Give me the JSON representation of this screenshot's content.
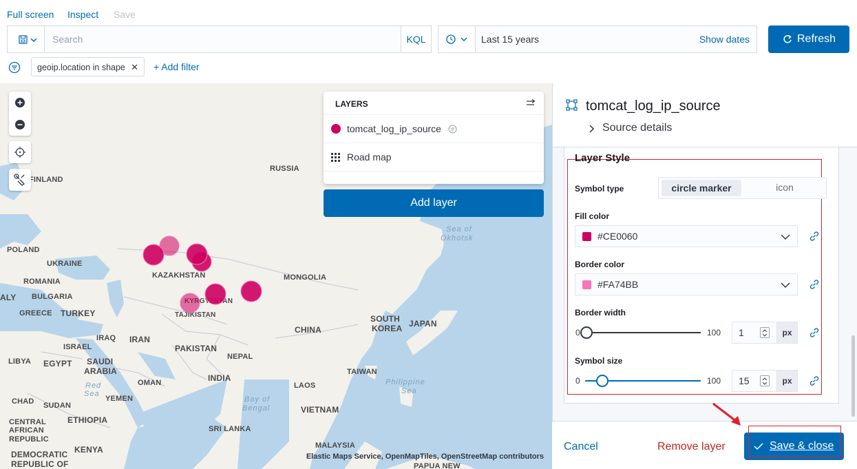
{
  "topnav": {
    "full_screen": "Full screen",
    "inspect": "Inspect",
    "save": "Save"
  },
  "search": {
    "placeholder": "Search",
    "kql": "KQL"
  },
  "datepicker": {
    "range": "Last 15 years",
    "show_dates": "Show dates"
  },
  "refresh_label": "Refresh",
  "filter": {
    "pill": "geoip.location in shape",
    "add": "+ Add filter"
  },
  "map": {
    "labels": [
      "RUSSIA",
      "FINLAND",
      "POLAND",
      "UKRAINE",
      "ROMANIA",
      "BULGARIA",
      "GREECE",
      "TURKEY",
      "KAZAKHSTAN",
      "MONGOLIA",
      "KYRGYZSTAN",
      "TAJIKISTAN",
      "CHINA",
      "SOUTH",
      "KOREA",
      "JAPAN",
      "IRAQ",
      "IRAN",
      "ISRAEL",
      "LIBYA",
      "EGYPT",
      "SAUDI",
      "ARABIA",
      "PAKISTAN",
      "NEPAL",
      "INDIA",
      "OMAN",
      "YEMEN",
      "CHAD",
      "SUDAN",
      "ETHIOPIA",
      "CENTRAL",
      "AFRICAN",
      "REPUBLIC",
      "DEMOCRATIC",
      "REPUBLIC OF",
      "KENYA",
      "TAIWAN",
      "LAOS",
      "VIETNAM",
      "SRI LANKA",
      "MALAYSIA",
      "PAPUA NEW",
      "ALY"
    ],
    "seas": [
      "Sea of",
      "Okhotsk",
      "Red",
      "Sea",
      "Bay of",
      "Bengal",
      "Philippine",
      "Sea"
    ],
    "attribution": "Elastic Maps Service, OpenMapTiles, OpenStreetMap contributors",
    "marker_fill": "#CE0060",
    "marker_border": "#FA74BB"
  },
  "layers": {
    "title": "LAYERS",
    "items": [
      {
        "name": "tomcat_log_ip_source",
        "icon": "circle-marker-icon"
      },
      {
        "name": "Road map",
        "icon": "grid-icon"
      }
    ],
    "add_button": "Add layer"
  },
  "panel": {
    "title": "tomcat_log_ip_source",
    "source_details": "Source details",
    "section_title": "Layer Style",
    "symbol_type": {
      "label": "Symbol type",
      "options": [
        "circle marker",
        "icon"
      ],
      "selected": "circle marker"
    },
    "fill_color": {
      "label": "Fill color",
      "value": "#CE0060"
    },
    "border_color": {
      "label": "Border color",
      "value": "#FA74BB"
    },
    "border_width": {
      "label": "Border width",
      "min": "0",
      "max": "100",
      "value": "1",
      "unit": "px",
      "level": 0.01
    },
    "symbol_size": {
      "label": "Symbol size",
      "min": "0",
      "max": "100",
      "value": "15",
      "unit": "px",
      "level": 0.15
    }
  },
  "footer": {
    "cancel": "Cancel",
    "remove": "Remove layer",
    "save_close": "Save & close"
  }
}
